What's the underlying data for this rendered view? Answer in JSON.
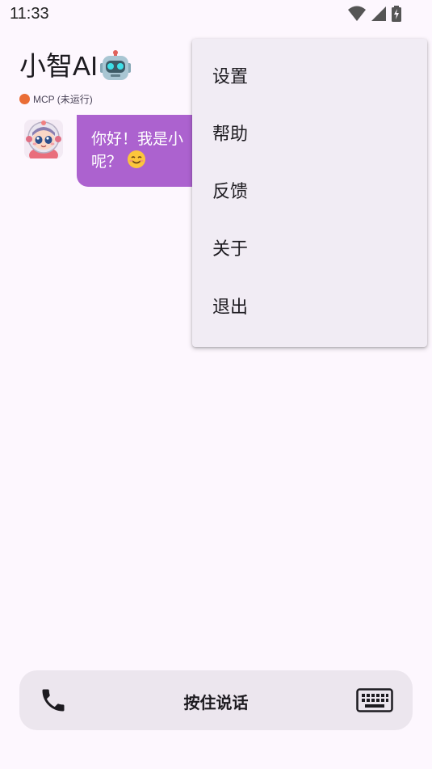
{
  "status_bar": {
    "time": "11:33",
    "icons": [
      "wifi-icon",
      "cell-signal-icon",
      "battery-charging-icon"
    ]
  },
  "header": {
    "title": "小智AI",
    "title_emoji": "robot-icon",
    "mcp_status": "MCP (未运行)",
    "mcp_status_color": "#ea6d35"
  },
  "chat": {
    "messages": [
      {
        "sender": "assistant",
        "avatar": "robot-girl-avatar",
        "text": "你好！我是小",
        "text_line2": "呢？",
        "emoji": "smiling-face-icon",
        "bubble_color": "#ac62cf"
      }
    ]
  },
  "menu": {
    "items": [
      {
        "label": "设置"
      },
      {
        "label": "帮助"
      },
      {
        "label": "反馈"
      },
      {
        "label": "关于"
      },
      {
        "label": "退出"
      }
    ]
  },
  "bottom_bar": {
    "call_icon": "phone-icon",
    "hold_to_talk_label": "按住说话",
    "keyboard_icon": "keyboard-icon"
  }
}
